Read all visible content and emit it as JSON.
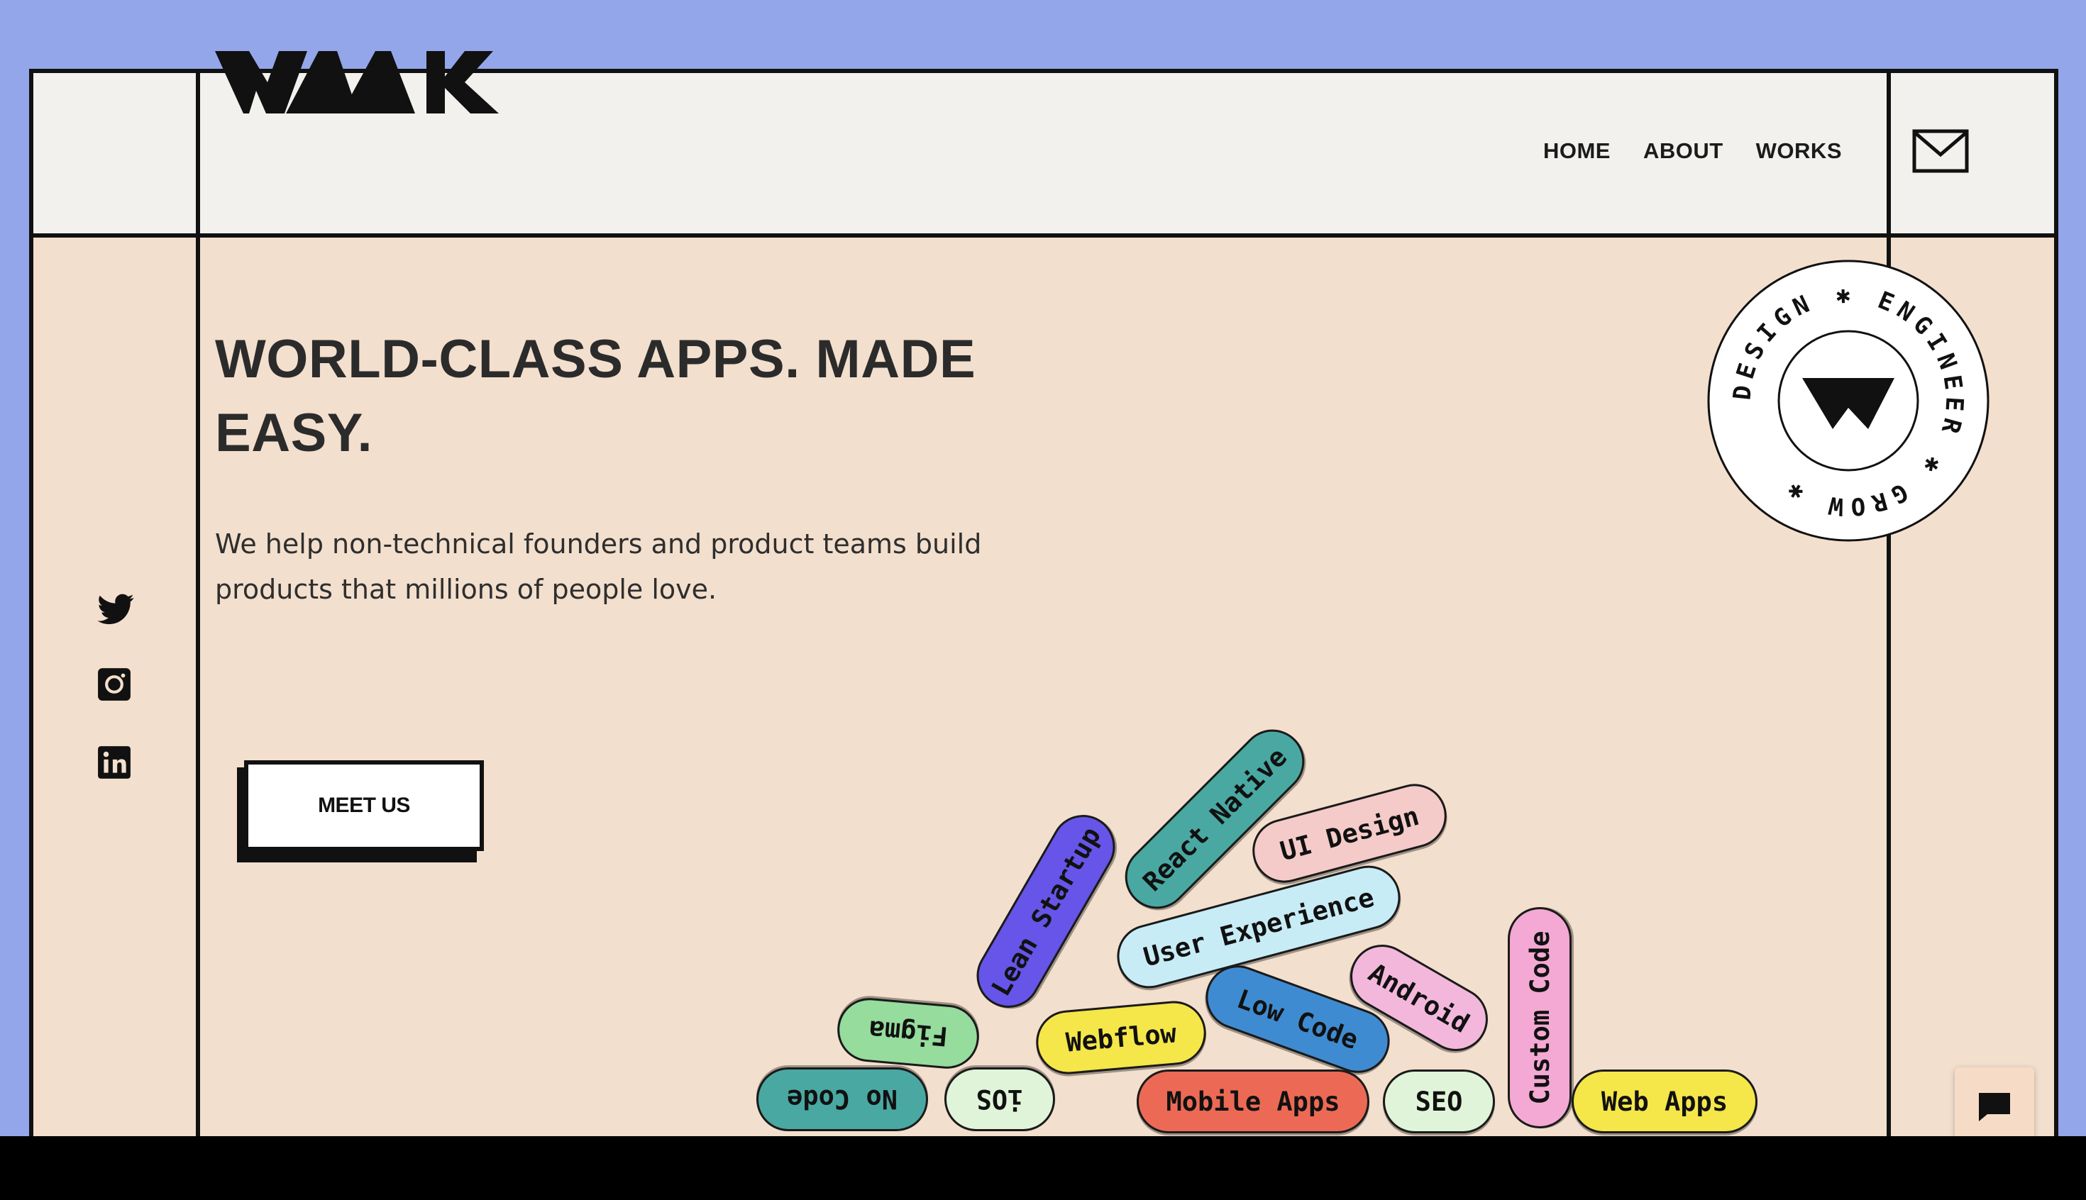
{
  "brand": {
    "logo_text": "WAAK"
  },
  "nav": {
    "items": [
      {
        "label": "HOME"
      },
      {
        "label": "ABOUT"
      },
      {
        "label": "WORKS"
      }
    ]
  },
  "icons": {
    "mail": "mail-icon",
    "twitter": "twitter-icon",
    "instagram": "instagram-icon",
    "linkedin": "linkedin-icon",
    "chat": "chat-icon"
  },
  "hero": {
    "title_line1": "WORLD-CLASS APPS. MADE",
    "title_line2": "EASY.",
    "lead_line1": "We help non-technical founders and product teams build",
    "lead_line2": "products that millions of people love.",
    "cta_label": "MEET US"
  },
  "badge": {
    "text": "DESIGN ✱ ENGINEER ✱ GROW ✱"
  },
  "tags": [
    {
      "label": "Lean Startup",
      "color": "#6655e8"
    },
    {
      "label": "React Native",
      "color": "#4aa8a2"
    },
    {
      "label": "UI Design",
      "color": "#f4cbc9"
    },
    {
      "label": "User Experience",
      "color": "#c8ecf6"
    },
    {
      "label": "Android",
      "color": "#f3b7dc"
    },
    {
      "label": "Custom Code",
      "color": "#f3a9d3"
    },
    {
      "label": "Low Code",
      "color": "#3f8bd1"
    },
    {
      "label": "Webflow",
      "color": "#f5e64a"
    },
    {
      "label": "Figma",
      "color": "#95dc9d"
    },
    {
      "label": "No Code",
      "color": "#4aa8a2"
    },
    {
      "label": "iOS",
      "color": "#e0f4d9"
    },
    {
      "label": "Mobile Apps",
      "color": "#ec6a55"
    },
    {
      "label": "SEO",
      "color": "#e0f4d9"
    },
    {
      "label": "Web Apps",
      "color": "#f5e64a"
    }
  ],
  "colors": {
    "page_bg": "#94a6ea",
    "hero_bg": "#f3dfcd",
    "header_bg": "#f2f1ee",
    "ink": "#111111"
  }
}
